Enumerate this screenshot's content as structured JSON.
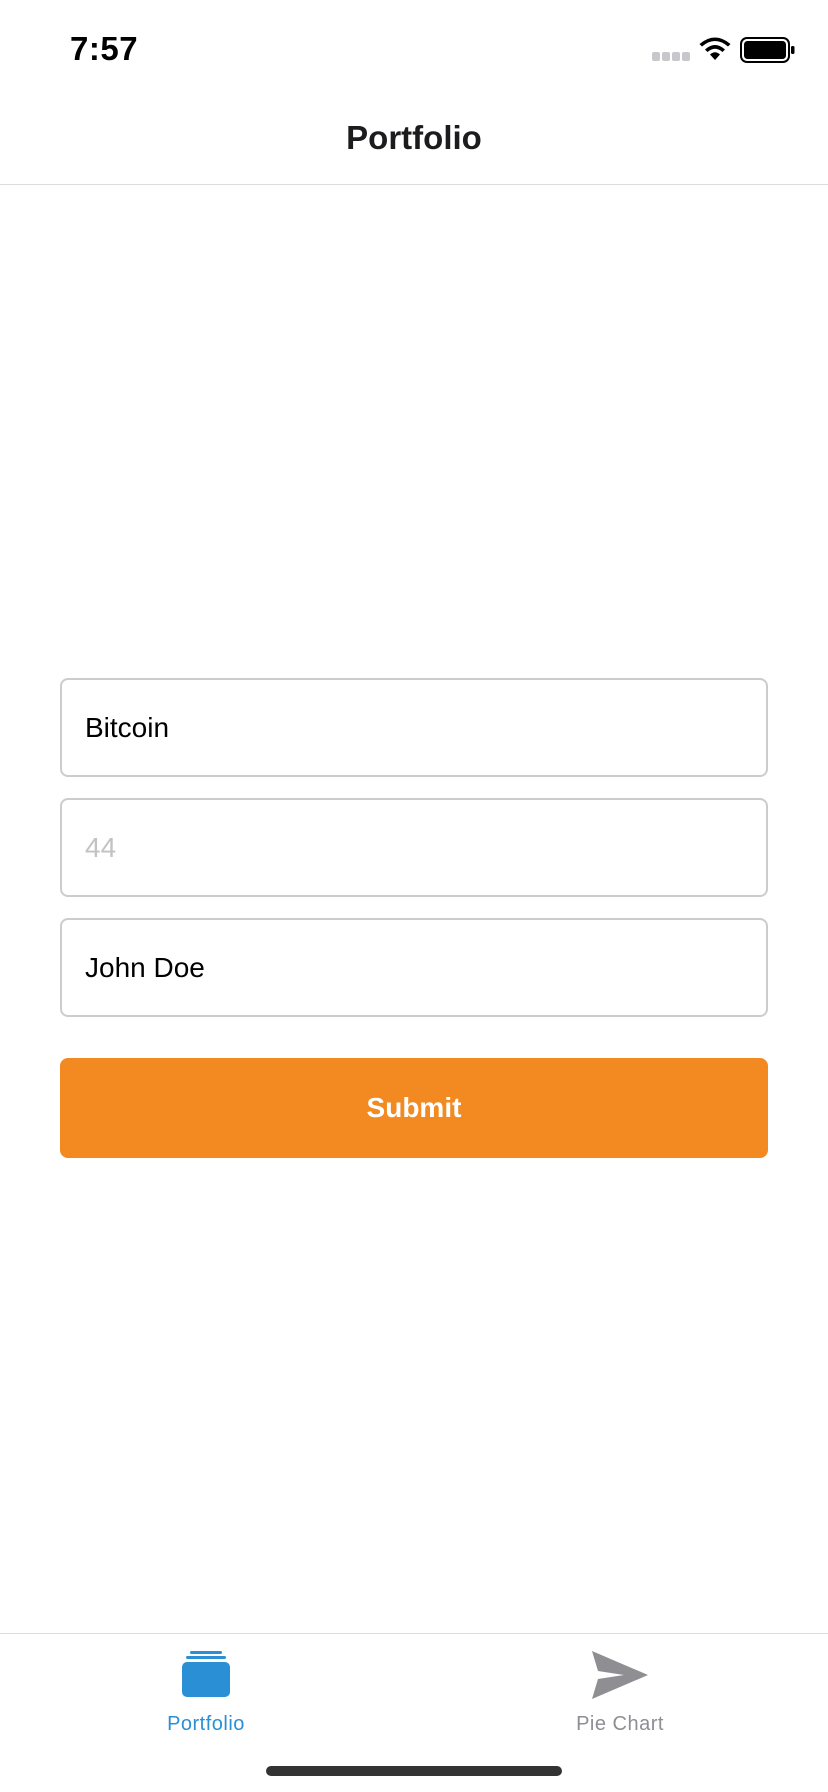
{
  "status_bar": {
    "time": "7:57",
    "icons": [
      "cellular-signal-icon",
      "wifi-icon",
      "battery-icon"
    ]
  },
  "nav": {
    "title": "Portfolio"
  },
  "form": {
    "coin_value": "Bitcoin",
    "amount_placeholder": "44",
    "amount_value": "",
    "owner_value": "John Doe",
    "submit_label": "Submit"
  },
  "tab_bar": {
    "tabs": [
      {
        "label": "Portfolio",
        "icon": "stack-icon",
        "active": true
      },
      {
        "label": "Pie Chart",
        "icon": "send-arrow-icon",
        "active": false
      }
    ]
  },
  "colors": {
    "accent": "#f28a21",
    "tab_active": "#2b8fd6",
    "tab_inactive": "#8e8e93",
    "border": "#cccccc"
  }
}
